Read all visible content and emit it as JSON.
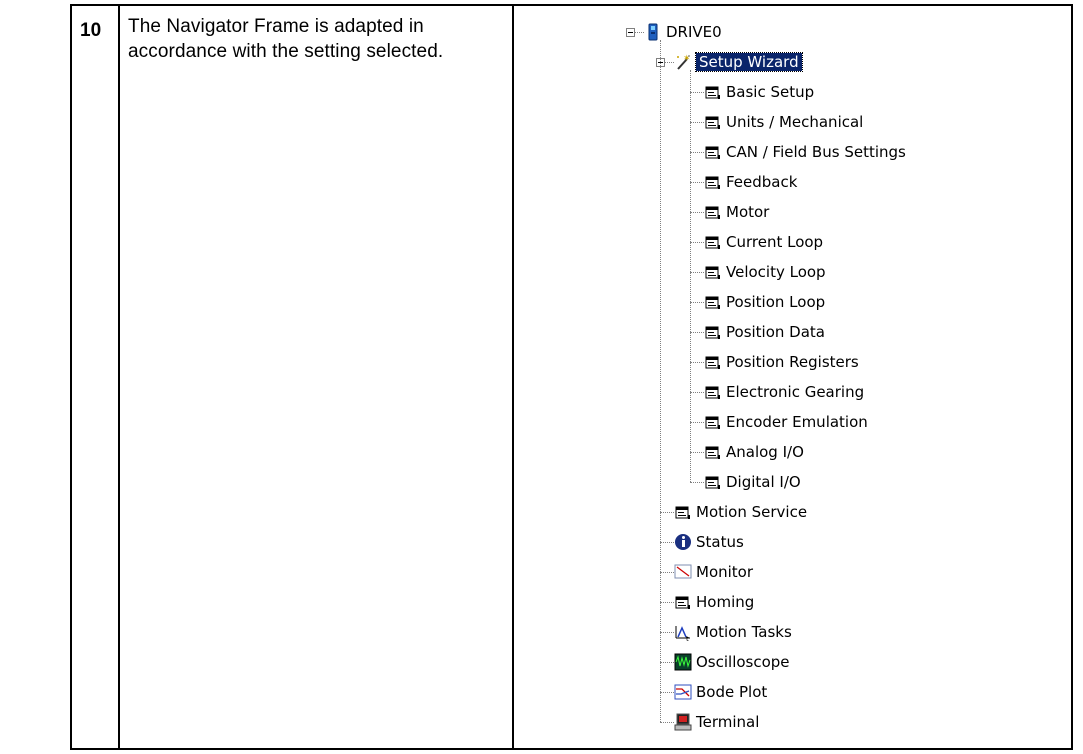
{
  "row": {
    "step": "10",
    "description": "The Navigator Frame is adapted in accordance with the setting selected."
  },
  "tree": {
    "root": {
      "label": "DRIVE0",
      "icon": "drive-icon"
    },
    "wizard": {
      "label": "Setup Wizard",
      "icon": "magic-wand-icon",
      "selected": true
    },
    "wizard_children": [
      {
        "label": "Basic Setup",
        "icon": "screen-page-icon"
      },
      {
        "label": "Units / Mechanical",
        "icon": "screen-page-icon"
      },
      {
        "label": "CAN / Field Bus Settings",
        "icon": "screen-page-icon"
      },
      {
        "label": "Feedback",
        "icon": "screen-page-icon"
      },
      {
        "label": "Motor",
        "icon": "screen-page-icon"
      },
      {
        "label": "Current Loop",
        "icon": "screen-page-icon"
      },
      {
        "label": "Velocity Loop",
        "icon": "screen-page-icon"
      },
      {
        "label": "Position Loop",
        "icon": "screen-page-icon"
      },
      {
        "label": "Position Data",
        "icon": "screen-page-icon"
      },
      {
        "label": "Position Registers",
        "icon": "screen-page-icon"
      },
      {
        "label": "Electronic Gearing",
        "icon": "screen-page-icon"
      },
      {
        "label": "Encoder Emulation",
        "icon": "screen-page-icon"
      },
      {
        "label": "Analog I/O",
        "icon": "screen-page-icon"
      },
      {
        "label": "Digital I/O",
        "icon": "screen-page-icon"
      }
    ],
    "root_children": [
      {
        "label": "Motion Service",
        "icon": "screen-page-icon"
      },
      {
        "label": "Status",
        "icon": "info-icon"
      },
      {
        "label": "Monitor",
        "icon": "monitor-icon"
      },
      {
        "label": "Homing",
        "icon": "screen-page-icon"
      },
      {
        "label": "Motion Tasks",
        "icon": "motion-tasks-icon"
      },
      {
        "label": "Oscilloscope",
        "icon": "oscilloscope-icon"
      },
      {
        "label": "Bode Plot",
        "icon": "bode-plot-icon"
      },
      {
        "label": "Terminal",
        "icon": "terminal-icon"
      }
    ]
  }
}
